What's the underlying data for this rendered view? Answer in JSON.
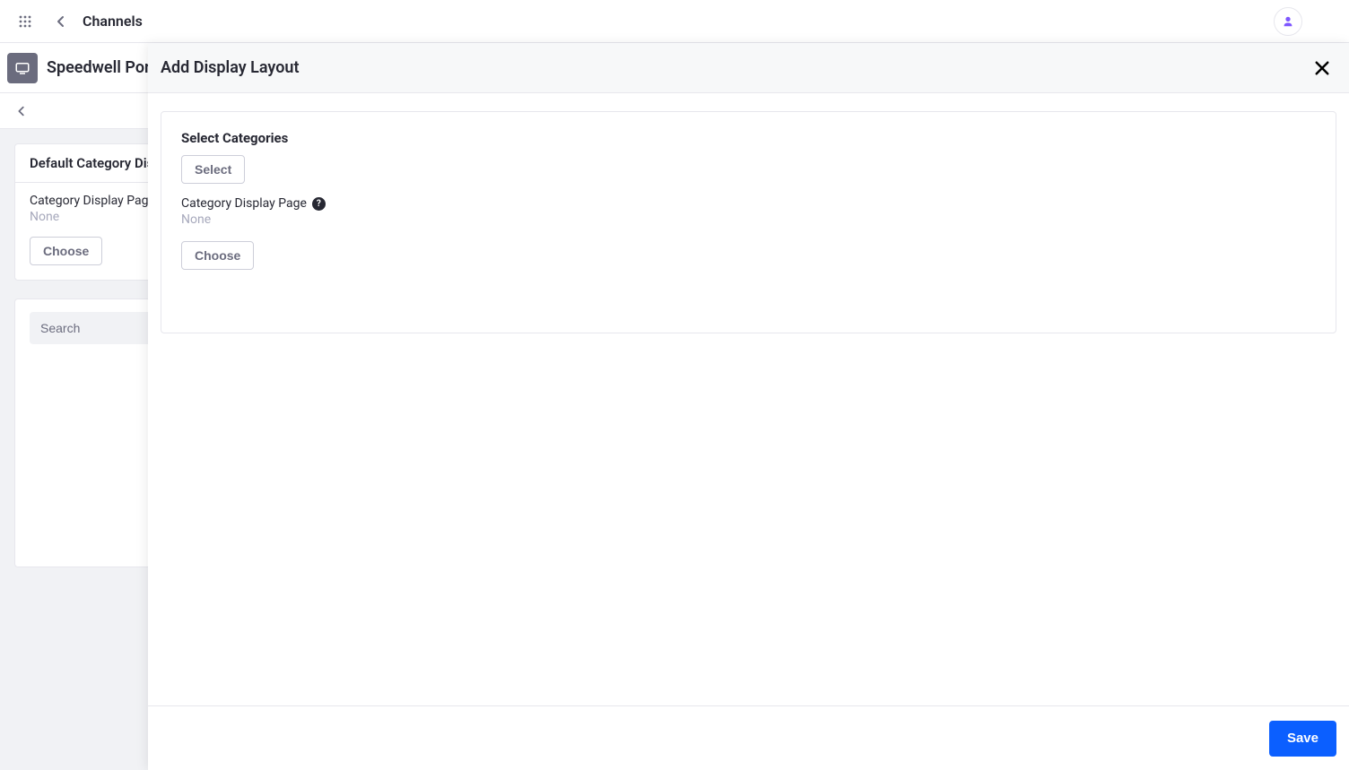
{
  "topbar": {
    "page_title": "Channels"
  },
  "subheader": {
    "site_title": "Speedwell Por"
  },
  "underlay": {
    "card_header": "Default Category Disp",
    "field_label": "Category Display Page",
    "field_value": "None",
    "choose_label": "Choose",
    "search_placeholder": "Search"
  },
  "panel": {
    "title": "Add Display Layout",
    "section_heading": "Select Categories",
    "select_label": "Select",
    "field_label": "Category Display Page",
    "field_value": "None",
    "choose_label": "Choose",
    "save_label": "Save",
    "help_glyph": "?"
  }
}
